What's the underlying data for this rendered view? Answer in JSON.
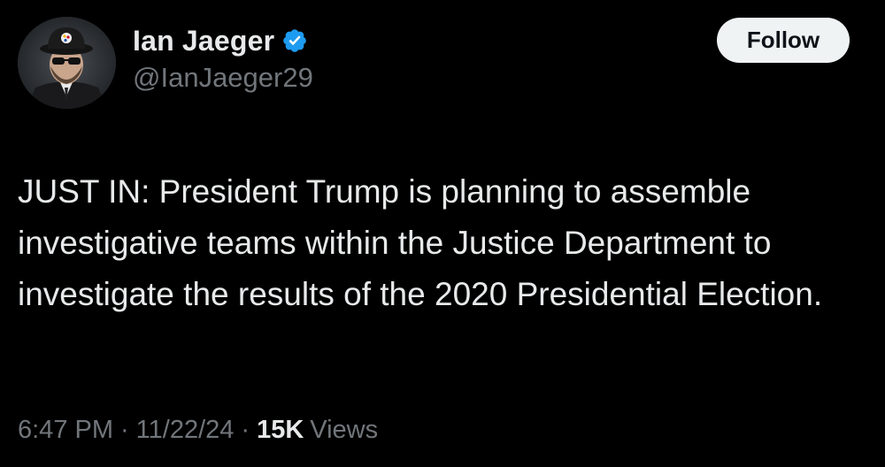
{
  "author": {
    "display_name": "Ian Jaeger",
    "handle": "@IanJaeger29",
    "verified": true,
    "verified_color": "#1d9bf0"
  },
  "actions": {
    "follow_label": "Follow"
  },
  "tweet": {
    "text": "JUST IN: President Trump is planning to assemble investigative teams within the Justice Department to investigate the results of the 2020 Presidential Election."
  },
  "meta": {
    "time": "6:47 PM",
    "separator": "·",
    "date": "11/22/24",
    "views_count": "15K",
    "views_label": "Views"
  },
  "theme": {
    "background": "#000000",
    "primary_text": "#e7e9ea",
    "secondary_text": "#71767b",
    "button_bg": "#eff3f4"
  }
}
